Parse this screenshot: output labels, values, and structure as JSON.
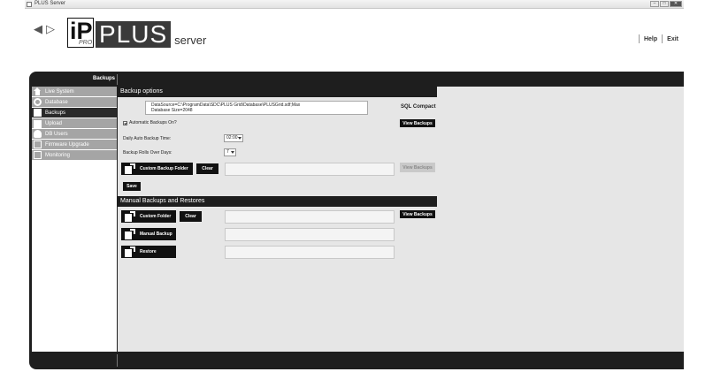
{
  "window": {
    "title": "PLUS Server",
    "controls": [
      "minimize",
      "maximize",
      "close"
    ]
  },
  "header": {
    "logo": {
      "ip": "iP",
      "pro": "PRO",
      "plus": "PLUS",
      "server": "server"
    },
    "links": {
      "help": "Help",
      "exit": "Exit"
    }
  },
  "section_label": "Backups",
  "sidebar": {
    "items": [
      {
        "label": "Live System",
        "icon": "home-icon",
        "active": false
      },
      {
        "label": "Database",
        "icon": "gear-icon",
        "active": false
      },
      {
        "label": "Backups",
        "icon": "document-icon",
        "active": true
      },
      {
        "label": "Upload",
        "icon": "upload-icon",
        "active": false
      },
      {
        "label": "DB Users",
        "icon": "users-icon",
        "active": false
      },
      {
        "label": "Firmware Upgrade",
        "icon": "chip-icon",
        "active": false
      },
      {
        "label": "Monitoring",
        "icon": "monitor-icon",
        "active": false
      }
    ]
  },
  "backup_options": {
    "title": "Backup options",
    "datasource_line1": "DataSource=C:\\ProgramData\\SDC\\PLUS Grid\\Database\\PLUSGrid.sdf;Max",
    "datasource_line2": "Database Size=2048",
    "db_type": "SQL Compact",
    "view_backups": "View Backups",
    "auto_backups_label": "Automatic Backups On?",
    "auto_backups_checked": true,
    "daily_time_label": "Daily Auto Backup Time:",
    "daily_time_value": "02:00",
    "roll_days_label": "Backup Rolls Over Days:",
    "roll_days_value": "7",
    "custom_folder_button": "Custom Backup Folder",
    "clear_button": "Clear",
    "custom_folder_path": "",
    "view_backups_disabled": "View Backups",
    "save_button": "Save"
  },
  "manual": {
    "title": "Manual Backups and Restores",
    "custom_folder_button": "Custom Folder",
    "clear_button": "Clear",
    "custom_folder_path": "",
    "view_backups": "View Backups",
    "manual_backup_button": "Manual Backup",
    "manual_backup_path": "",
    "restore_button": "Restore",
    "restore_path": ""
  }
}
